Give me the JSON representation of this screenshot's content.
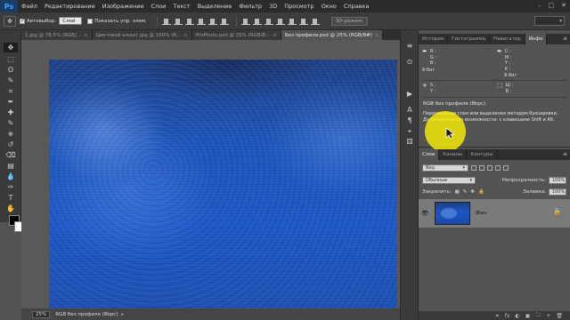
{
  "app": {
    "logo": "Ps"
  },
  "menu": [
    "Файл",
    "Редактирование",
    "Изображение",
    "Слои",
    "Текст",
    "Выделение",
    "Фильтр",
    "3D",
    "Просмотр",
    "Окно",
    "Справка"
  ],
  "window_controls": {
    "minimize": "–",
    "maximize": "□",
    "close": "✕"
  },
  "options": {
    "tool_icon": "✥",
    "autoselect_label": "Автовыбор:",
    "autoselect_value": "Слой",
    "show_controls_label": "Показать упр. элем.",
    "mode_3d_label": "3D-режим:",
    "workspace_value": "",
    "autoselect_checked": true,
    "show_controls_checked": false
  },
  "tools": [
    "move-icon",
    "marquee-icon",
    "lasso-icon",
    "quick-select-icon",
    "crop-icon",
    "eyedropper-icon",
    "healing-icon",
    "brush-icon",
    "stamp-icon",
    "history-brush-icon",
    "eraser-icon",
    "gradient-icon",
    "blur-icon",
    "dodge-icon",
    "pen-icon",
    "type-icon",
    "path-select-icon",
    "shape-icon",
    "hand-icon",
    "zoom-icon"
  ],
  "tool_glyphs": [
    "✥",
    "⬚",
    "ʘ",
    "✎",
    "⌗",
    "✒",
    "✚",
    "✎",
    "⎈",
    "↺",
    "⌫",
    "▤",
    "💧",
    "◐",
    "✑",
    "T",
    "➤",
    "▭",
    "✋",
    "⚲"
  ],
  "tabs": [
    {
      "label": "1.jpg @ 78,5% (RGB/...",
      "close": "×",
      "active": false
    },
    {
      "label": "Цветовой ажаат.jpg @ 100% (R...",
      "close": "×",
      "active": false
    },
    {
      "label": "ProPhoto.psd @ 25% (RGB/8...",
      "close": "×",
      "active": false
    },
    {
      "label": "Без профиля.psd @ 25% (RGB/8#)",
      "close": "×",
      "active": true
    }
  ],
  "status": {
    "zoom": "25%",
    "doc_info": "RGB без профиля (8bpc)",
    "arrow": "▸"
  },
  "icon_column": [
    "≡",
    "⊙",
    "▶",
    "A",
    "¶",
    "⌖",
    "⚄"
  ],
  "info_panel": {
    "tabs": [
      "История",
      "Гистограмма",
      "Навигатор",
      "Инфо"
    ],
    "active_tab": 3,
    "menu": "≡",
    "rgb": {
      "r": "R :",
      "g": "G :",
      "b": "B :",
      "bit": "8-бит"
    },
    "cmyk": {
      "c": "C :",
      "m": "M :",
      "y": "Y :",
      "k": "K :",
      "bit": "8-бит"
    },
    "xy": {
      "x": "X :",
      "y": "Y :"
    },
    "wh": {
      "w": "Ш :",
      "h": "В :"
    },
    "profile": "RGB без профиля (8bpc)",
    "hint": "Перемещение слоя или выделения методом буксировки. Дополнительные возможности: с клавишами Shift и Alt."
  },
  "layers_panel": {
    "tabs": [
      "Слои",
      "Каналы",
      "Контуры"
    ],
    "active_tab": 0,
    "menu": "≡",
    "filter_label": "Вид",
    "blend_mode": "Обычные",
    "opacity_label": "Непрозрачность:",
    "opacity_value": "100%",
    "lock_label": "Закрепить:",
    "fill_label": "Заливка:",
    "fill_value": "100%",
    "layer": {
      "name": "Фон",
      "visible": true,
      "locked": true
    }
  },
  "layers_bottom": [
    "⚭",
    "fx",
    "◐",
    "▣",
    "🗀",
    "+",
    "🗑"
  ]
}
